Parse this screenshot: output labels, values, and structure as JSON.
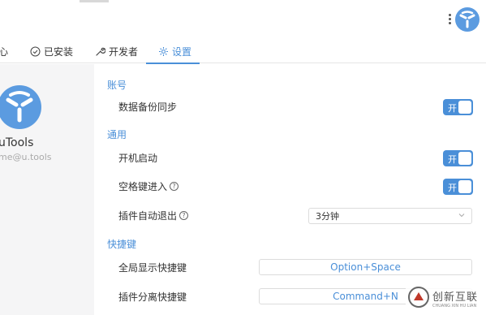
{
  "tabs": [
    {
      "label": "心",
      "icon": "none"
    },
    {
      "label": "已安装",
      "icon": "check-circle-icon"
    },
    {
      "label": "开发者",
      "icon": "wrench-icon"
    },
    {
      "label": "设置",
      "icon": "gear-icon",
      "active": true
    }
  ],
  "profile": {
    "name": "uTools",
    "email": "me@u.tools"
  },
  "sections": {
    "account": {
      "title": "账号",
      "rows": [
        {
          "label": "数据备份同步",
          "toggle": "开",
          "on": true
        }
      ]
    },
    "general": {
      "title": "通用",
      "rows": [
        {
          "label": "开机启动",
          "toggle": "开",
          "on": true
        },
        {
          "label": "空格键进入",
          "help": "?",
          "toggle": "开",
          "on": true
        },
        {
          "label": "插件自动退出",
          "help": "?",
          "select": "3分钟"
        }
      ]
    },
    "shortcuts": {
      "title": "快捷键",
      "rows": [
        {
          "label": "全局显示快捷键",
          "value": "Option+Space"
        },
        {
          "label": "插件分离快捷键",
          "value": "Command+N"
        }
      ]
    }
  },
  "watermark": {
    "text": "创新互联",
    "sub": "CHUANG XIN HU LIAN"
  },
  "colors": {
    "accent": "#4a8fd8",
    "sidebar": "#f5f5f6",
    "logo": "#5b9be0"
  }
}
